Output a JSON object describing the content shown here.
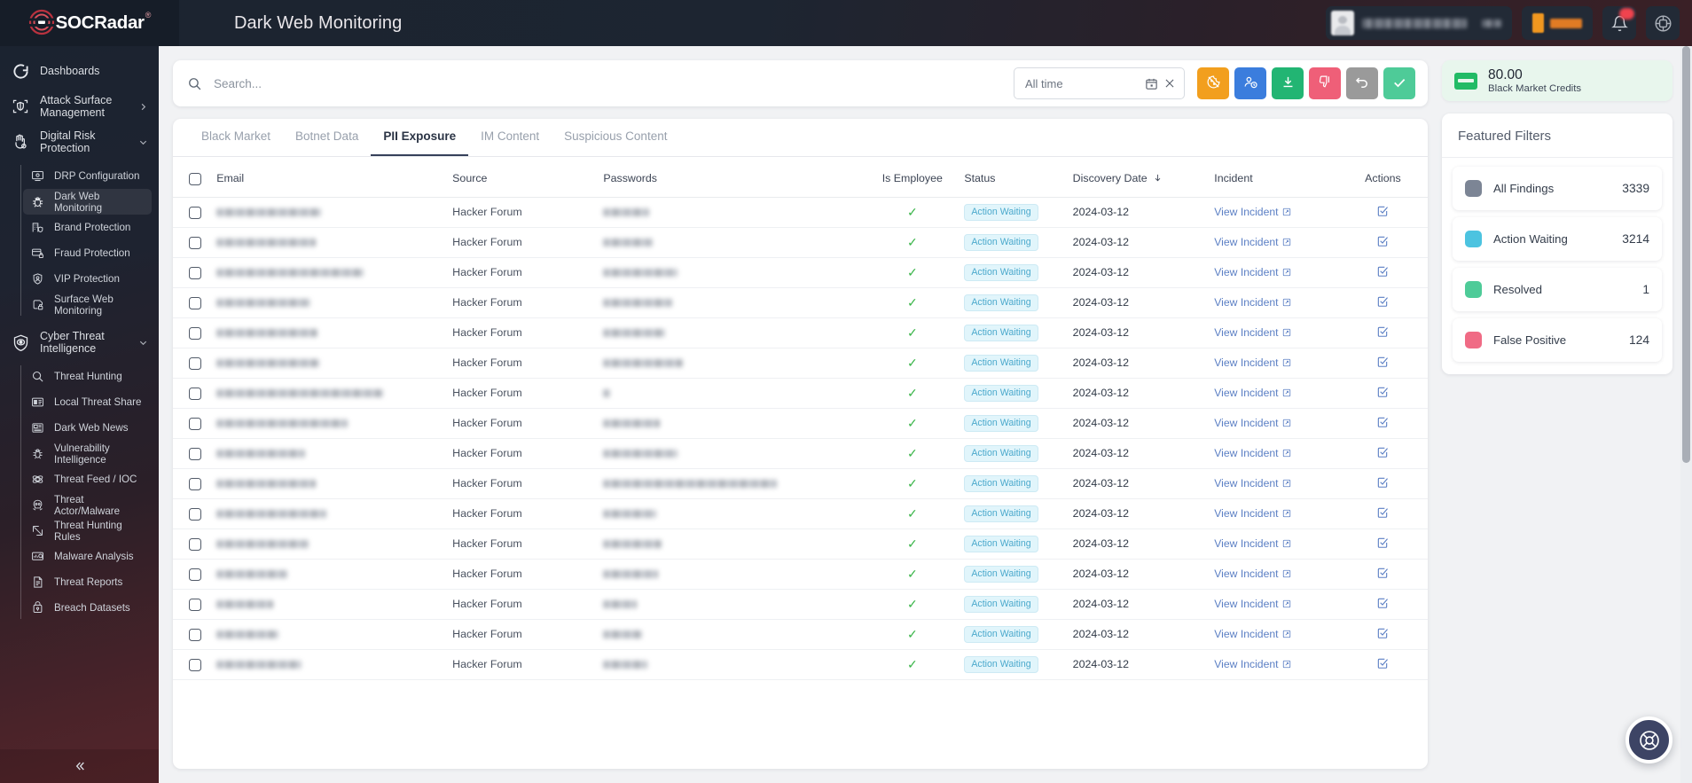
{
  "brand": {
    "name": "SOCRadar",
    "trademark": "®"
  },
  "header": {
    "title": "Dark Web Monitoring",
    "user_chip_icon": "user-avatar-icon",
    "notifications_icon": "bell-icon",
    "apps_icon": "apps-grid-icon"
  },
  "sidebar": {
    "collapse_label": "«",
    "groups": [
      {
        "label": "Dashboards",
        "icon": "dashboard-icon",
        "expandable": false
      },
      {
        "label": "Attack Surface Management",
        "icon": "shield-scan-icon",
        "expandable": true,
        "expanded": false
      },
      {
        "label": "Digital Risk Protection",
        "icon": "hand-shield-icon",
        "expandable": true,
        "expanded": true,
        "items": [
          {
            "label": "DRP Configuration",
            "icon": "monitor-icon",
            "active": false
          },
          {
            "label": "Dark Web Monitoring",
            "icon": "bug-icon",
            "active": true
          },
          {
            "label": "Brand Protection",
            "icon": "building-shield-icon",
            "active": false
          },
          {
            "label": "Fraud Protection",
            "icon": "card-lock-icon",
            "active": false
          },
          {
            "label": "VIP Protection",
            "icon": "user-shield-icon",
            "active": false
          },
          {
            "label": "Surface Web Monitoring",
            "icon": "globe-lock-icon",
            "active": false
          }
        ]
      },
      {
        "label": "Cyber Threat Intelligence",
        "icon": "shield-eye-icon",
        "expandable": true,
        "expanded": true,
        "items": [
          {
            "label": "Threat Hunting",
            "icon": "magnifier-icon",
            "active": false
          },
          {
            "label": "Local Threat Share",
            "icon": "news-card-icon",
            "active": false
          },
          {
            "label": "Dark Web News",
            "icon": "newspaper-icon",
            "active": false
          },
          {
            "label": "Vulnerability Intelligence",
            "icon": "bug-alert-icon",
            "active": false
          },
          {
            "label": "Threat Feed / IOC",
            "icon": "network-nodes-icon",
            "active": false
          },
          {
            "label": "Threat Actor/Malware",
            "icon": "skull-icon",
            "active": false
          },
          {
            "label": "Threat Hunting Rules",
            "icon": "rule-box-icon",
            "active": false
          },
          {
            "label": "Malware Analysis",
            "icon": "chart-monitor-icon",
            "active": false
          },
          {
            "label": "Threat Reports",
            "icon": "report-icon",
            "active": false
          },
          {
            "label": "Breach Datasets",
            "icon": "database-lock-icon",
            "active": false
          }
        ]
      }
    ]
  },
  "search": {
    "placeholder": "Search...",
    "value": "",
    "icon": "search-icon"
  },
  "date_filter": {
    "value": "All time",
    "calendar_icon": "calendar-icon",
    "clear_icon": "close-icon"
  },
  "action_buttons": [
    {
      "name": "mark-as-read-button",
      "icon": "cookie-slash-icon",
      "color": "#f29f1e"
    },
    {
      "name": "assign-button",
      "icon": "user-clock-icon",
      "color": "#3b7ddd"
    },
    {
      "name": "download-button",
      "icon": "download-icon",
      "color": "#22b573"
    },
    {
      "name": "false-positive-button",
      "icon": "thumbs-down-icon",
      "color": "#ef5f78"
    },
    {
      "name": "undo-button",
      "icon": "undo-arrow-icon",
      "color": "#9a9a9a"
    },
    {
      "name": "resolve-button",
      "icon": "check-icon",
      "color": "#4ecb98"
    }
  ],
  "tabs": [
    {
      "label": "Black Market",
      "active": false
    },
    {
      "label": "Botnet Data",
      "active": false
    },
    {
      "label": "PII Exposure",
      "active": true
    },
    {
      "label": "IM Content",
      "active": false
    },
    {
      "label": "Suspicious Content",
      "active": false
    }
  ],
  "table": {
    "columns": [
      {
        "key": "check",
        "label": "",
        "cls": "c-check"
      },
      {
        "key": "email",
        "label": "Email",
        "cls": "c-email"
      },
      {
        "key": "source",
        "label": "Source",
        "cls": "c-source"
      },
      {
        "key": "pass",
        "label": "Passwords",
        "cls": "c-pass"
      },
      {
        "key": "emp",
        "label": "Is Employee",
        "cls": "c-emp"
      },
      {
        "key": "status",
        "label": "Status",
        "cls": "c-status"
      },
      {
        "key": "date",
        "label": "Discovery Date",
        "cls": "c-date",
        "sort": "desc",
        "sort_icon": "arrow-down-icon"
      },
      {
        "key": "inc",
        "label": "Incident",
        "cls": "c-inc"
      },
      {
        "key": "act",
        "label": "Actions",
        "cls": "c-act"
      }
    ],
    "select_all_checked": false,
    "link_label": "View Incident",
    "rows": [
      {
        "email_w": 118,
        "pass_w": 52,
        "source": "Hacker Forum",
        "employee": "✓",
        "status": "Action Waiting",
        "date": "2024-03-12"
      },
      {
        "email_w": 112,
        "pass_w": 56,
        "source": "Hacker Forum",
        "employee": "✓",
        "status": "Action Waiting",
        "date": "2024-03-12"
      },
      {
        "email_w": 166,
        "pass_w": 84,
        "source": "Hacker Forum",
        "employee": "✓",
        "status": "Action Waiting",
        "date": "2024-03-12"
      },
      {
        "email_w": 106,
        "pass_w": 78,
        "source": "Hacker Forum",
        "employee": "✓",
        "status": "Action Waiting",
        "date": "2024-03-12"
      },
      {
        "email_w": 114,
        "pass_w": 70,
        "source": "Hacker Forum",
        "employee": "✓",
        "status": "Action Waiting",
        "date": "2024-03-12"
      },
      {
        "email_w": 116,
        "pass_w": 90,
        "source": "Hacker Forum",
        "employee": "✓",
        "status": "Action Waiting",
        "date": "2024-03-12"
      },
      {
        "email_w": 188,
        "pass_w": 8,
        "source": "Hacker Forum",
        "employee": "✓",
        "status": "Action Waiting",
        "date": "2024-03-12"
      },
      {
        "email_w": 148,
        "pass_w": 64,
        "source": "Hacker Forum",
        "employee": "✓",
        "status": "Action Waiting",
        "date": "2024-03-12"
      },
      {
        "email_w": 100,
        "pass_w": 84,
        "source": "Hacker Forum",
        "employee": "✓",
        "status": "Action Waiting",
        "date": "2024-03-12"
      },
      {
        "email_w": 112,
        "pass_w": 196,
        "source": "Hacker Forum",
        "employee": "✓",
        "status": "Action Waiting",
        "date": "2024-03-12"
      },
      {
        "email_w": 124,
        "pass_w": 60,
        "source": "Hacker Forum",
        "employee": "✓",
        "status": "Action Waiting",
        "date": "2024-03-12"
      },
      {
        "email_w": 104,
        "pass_w": 66,
        "source": "Hacker Forum",
        "employee": "✓",
        "status": "Action Waiting",
        "date": "2024-03-12"
      },
      {
        "email_w": 80,
        "pass_w": 62,
        "source": "Hacker Forum",
        "employee": "✓",
        "status": "Action Waiting",
        "date": "2024-03-12"
      },
      {
        "email_w": 64,
        "pass_w": 38,
        "source": "Hacker Forum",
        "employee": "✓",
        "status": "Action Waiting",
        "date": "2024-03-12"
      },
      {
        "email_w": 70,
        "pass_w": 44,
        "source": "Hacker Forum",
        "employee": "✓",
        "status": "Action Waiting",
        "date": "2024-03-12"
      },
      {
        "email_w": 96,
        "pass_w": 50,
        "source": "Hacker Forum",
        "employee": "✓",
        "status": "Action Waiting",
        "date": "2024-03-12"
      }
    ]
  },
  "credits": {
    "value": "80.00",
    "label": "Black Market Credits",
    "icon": "credit-card-icon",
    "accent": "#22bb66"
  },
  "featured_filters": {
    "title": "Featured Filters",
    "items": [
      {
        "label": "All Findings",
        "count": "3339",
        "color": "#7c8595"
      },
      {
        "label": "Action Waiting",
        "count": "3214",
        "color": "#4cc3e0"
      },
      {
        "label": "Resolved",
        "count": "1",
        "color": "#4ecb98"
      },
      {
        "label": "False Positive",
        "count": "124",
        "color": "#f06b85"
      }
    ]
  },
  "support": {
    "icon": "lifebuoy-icon",
    "label": ""
  }
}
